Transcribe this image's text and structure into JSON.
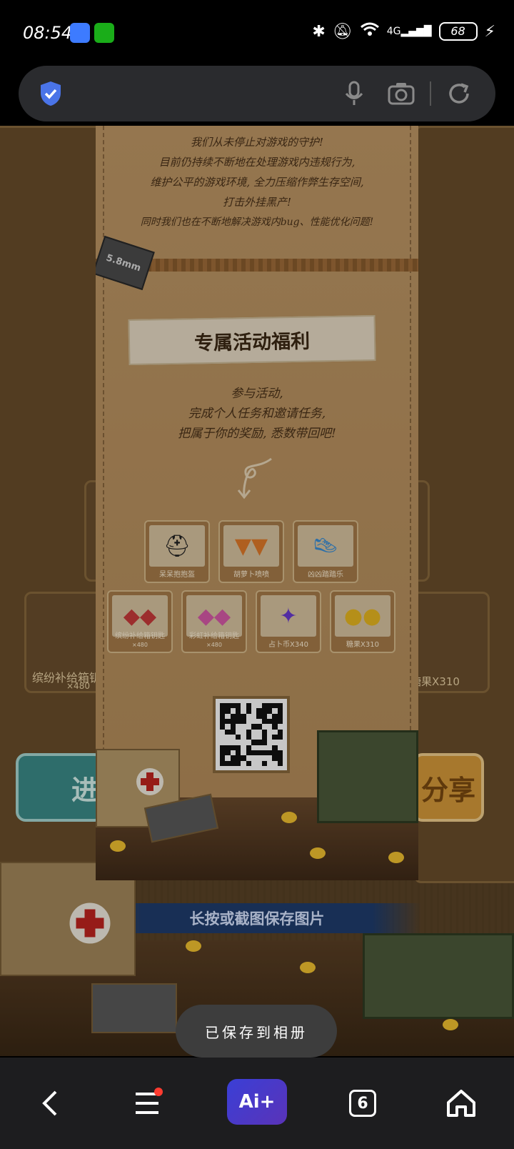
{
  "status_bar": {
    "time": "08:54",
    "battery": "68",
    "network": "4G"
  },
  "search_bar": {
    "placeholder": ""
  },
  "poster": {
    "message_lines": [
      "我们从未停止对游戏的守护!",
      "目前仍持续不断地在处理游戏内违规行为,",
      "维护公平的游戏环境, 全力压缩作弊生存空间,",
      "打击外挂黑产!",
      "同时我们也在不断地解决游戏内bug、性能优化问题!"
    ],
    "ammo_label": "5.8mm",
    "section_title": "专属活动福利",
    "description_lines": [
      "参与活动,",
      "完成个人任务和邀请任务,",
      "把属于你的奖励, 悉数带回吧!"
    ],
    "rewards_row1": [
      {
        "label": "呆呆抱抱盔",
        "icon": "helmet-icon"
      },
      {
        "label": "胡萝卜喷喷",
        "icon": "carrot-icon"
      },
      {
        "label": "凶凶踏踏乐",
        "icon": "shoes-icon"
      }
    ],
    "rewards_row2": [
      {
        "label": "缤纷补给箱钥匙",
        "sub": "×480",
        "icon": "key-red-icon"
      },
      {
        "label": "彩虹补给箱钥匙",
        "sub": "×480",
        "icon": "key-pink-icon"
      },
      {
        "label": "占卜币X340",
        "sub": "",
        "icon": "coin-icon"
      },
      {
        "label": "糖果X310",
        "sub": "",
        "icon": "candy-icon"
      }
    ]
  },
  "background_page": {
    "left_card_label": "缤纷补给箱钥",
    "left_card_sub": "×480",
    "right_card_label": "糖果X310",
    "left_button_text": "进",
    "right_button_text": "分享",
    "save_hint": "长按或截图保存图片"
  },
  "toast": {
    "text": "已保存到相册"
  },
  "nav_bar": {
    "ai_label": "Ai+",
    "tab_count": "6"
  },
  "colors": {
    "poster_bg": "#b9915f",
    "nav_bg": "#1d1d1f",
    "ai_gradient_start": "#3a3fd6",
    "toast_bg": "#3d3d3d"
  }
}
